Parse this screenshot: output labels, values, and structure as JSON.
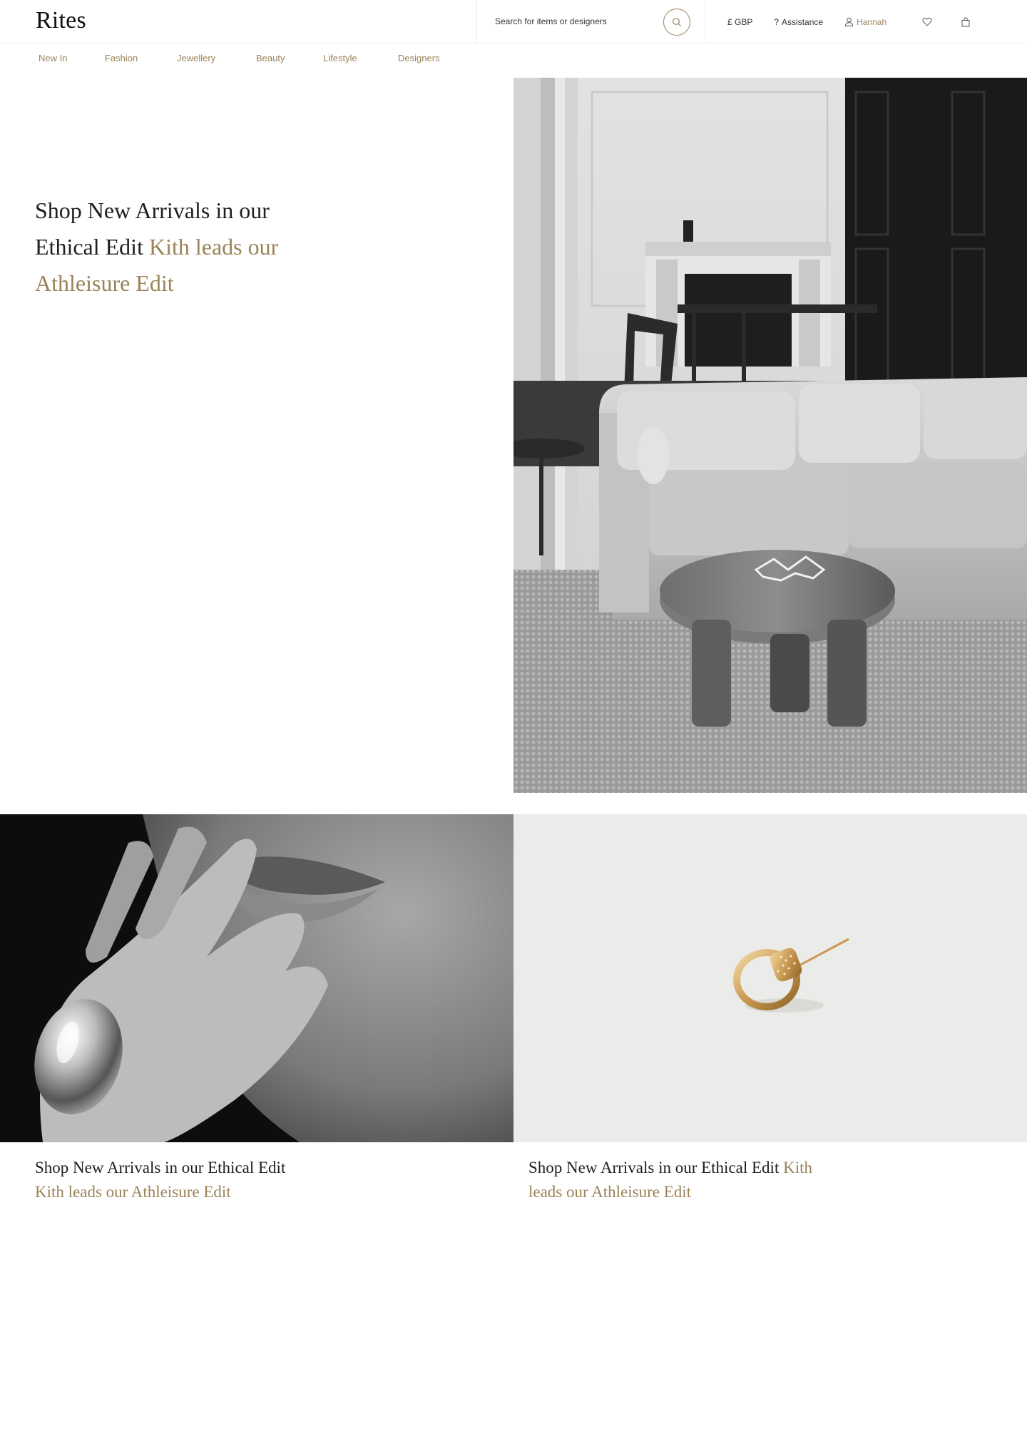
{
  "brand": {
    "logo": "Rites"
  },
  "header": {
    "search_placeholder": "Search for items or designers",
    "currency": "£ GBP",
    "assistance": "Assistance",
    "assistance_glyph": "?",
    "user_name": "Hannah",
    "icons": [
      "search-icon",
      "user-icon",
      "heart-icon",
      "bag-icon"
    ]
  },
  "nav": {
    "items": [
      {
        "label": "New In"
      },
      {
        "label": "Fashion"
      },
      {
        "label": "Jewellery"
      },
      {
        "label": "Beauty"
      },
      {
        "label": "Lifestyle"
      },
      {
        "label": "Designers"
      }
    ]
  },
  "hero": {
    "text_dark": "Shop New Arrivals in our Ethical Edit",
    "text_gold": "Kith leads our Athleisure Edit"
  },
  "tiles": [
    {
      "text_dark": "Shop New Arrivals in our Ethical Edit",
      "text_gold": "Kith leads our Athleisure Edit"
    },
    {
      "text_dark": "Shop New Arrivals in our Ethical Edit",
      "text_gold": "Kith leads our Athleisure Edit"
    }
  ],
  "colors": {
    "accent": "#9a8358",
    "text": "#1f1f1f",
    "border": "#ececec"
  }
}
